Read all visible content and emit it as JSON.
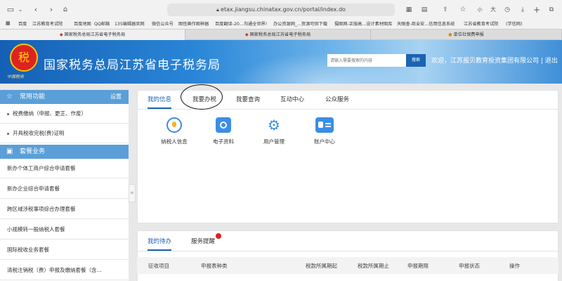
{
  "browser": {
    "url": "etax.jiangsu.chinatax.gov.cn/portal/index.do",
    "small_a": "小",
    "large_a": "大",
    "bookmarks": [
      "百度",
      "江苏教育考试院",
      "百度地图",
      "QQ邮箱",
      "135编辑器官网",
      "微信公众号",
      "图怪兽作图神器",
      "百度翻译-20...沟通全世界!",
      "办公资源网_...资源可供下载",
      "摄图网-正版高...设计素材图库",
      "天眼查-商业安...信用信息系统",
      "江苏省教育考试院",
      "(学信网)"
    ],
    "tabs": [
      "国家税务总局江苏省电子税务局",
      "国家税务总局江苏省电子税务局",
      "单位社保费申报"
    ]
  },
  "header": {
    "emblem_char": "税",
    "emblem_text": "中国税务",
    "site_title": "国家税务总局江苏省电子税务局",
    "search_placeholder": "请输入需要搜索的内容",
    "search_button": "搜索",
    "welcome": "欢迎，江苏报贝教育投资集团有限公司 | 退出"
  },
  "sidebar": {
    "section1_title": "常用功能",
    "settings": "设置",
    "section1_items": [
      "税费缴纳（申报、更正、作废）",
      "开具税收完税(费)证明"
    ],
    "section2_title": "套餐业务",
    "section2_items": [
      "新办个体工商户综合申请套餐",
      "新办企业综合申请套餐",
      "跨区域涉税事项综合办理套餐",
      "小规模转一般纳税人套餐",
      "国际税收业务套餐",
      "清税注销税（费）申报及缴纳套餐（含..."
    ]
  },
  "main": {
    "tabs": [
      "我的信息",
      "我要办税",
      "我要查询",
      "互动中心",
      "公众服务"
    ],
    "functions": [
      "纳税人信息",
      "电子资料",
      "用户管理",
      "账户中心"
    ]
  },
  "todo": {
    "tabs": [
      "我的待办",
      "服务提醒"
    ],
    "columns": [
      "征收项目",
      "申报表种类",
      "税款所属期起",
      "税款所属期止",
      "申报期限",
      "申报状态",
      "操作"
    ]
  },
  "colors": {
    "accent": "#1b63b3",
    "sidebar_head": "#5a9fd8",
    "annotation": "#111111",
    "badge": "#e02020"
  }
}
